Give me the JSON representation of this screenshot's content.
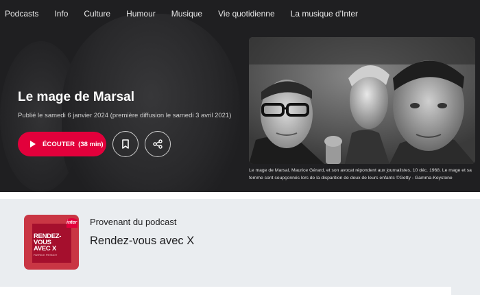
{
  "nav": {
    "items": [
      {
        "label": "Podcasts"
      },
      {
        "label": "Info"
      },
      {
        "label": "Culture"
      },
      {
        "label": "Humour"
      },
      {
        "label": "Musique"
      },
      {
        "label": "Vie quotidienne"
      },
      {
        "label": "La musique d'Inter"
      }
    ]
  },
  "episode": {
    "title": "Le mage de Marsal",
    "published": "Publié le samedi 6 janvier 2024 (première diffusion le samedi 3 avril 2021)",
    "listen_label": "ÉCOUTER",
    "duration": "(38 min)",
    "bookmark_icon": "bookmark-icon",
    "share_icon": "share-icon",
    "photo_caption": "Le mage de Marsal, Maurice Gérard, et son avocat répondent aux journalistes, 10 déc. 1968. Le mage et sa femme sont soupçonnés lors de la disparition de deux de leurs enfants ©Getty - Gamma-Keystone"
  },
  "podcast": {
    "from_label": "Provenant du podcast",
    "name": "Rendez-vous avec X",
    "cover_title": "RENDEZ-VOUS AVEC X",
    "cover_author": "PATRICK PESNOT",
    "cover_brand": "inter"
  },
  "colors": {
    "hero_bg": "#1f1f21",
    "accent": "#e2003b",
    "section_bg": "#eaedf0",
    "cover_bg": "#c93644"
  }
}
